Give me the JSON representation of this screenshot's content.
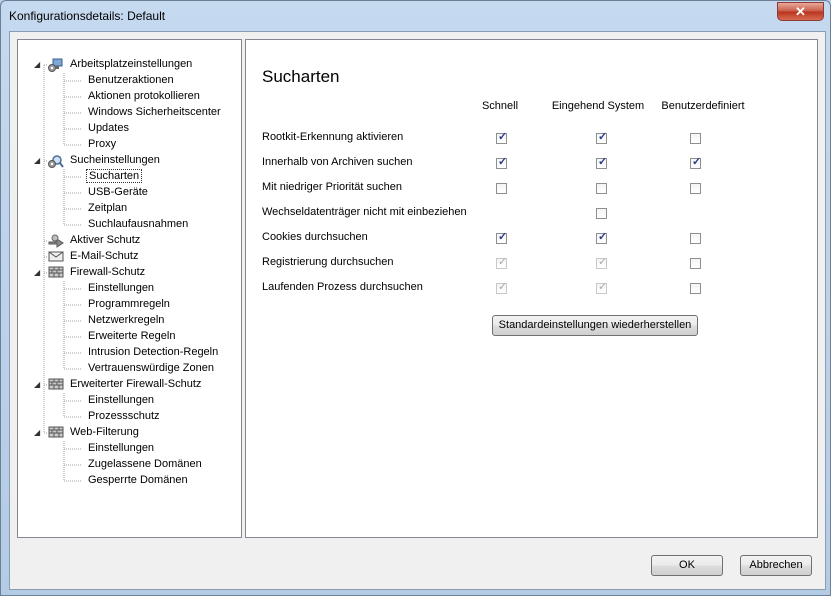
{
  "window": {
    "title": "Konfigurationsdetails: Default",
    "close_glyph": "✕"
  },
  "tree": {
    "items": [
      {
        "label": "Arbeitsplatzeinstellungen",
        "level": 0,
        "icon": "computer-gear-icon",
        "expanded": true
      },
      {
        "label": "Benutzeraktionen",
        "level": 1
      },
      {
        "label": "Aktionen protokollieren",
        "level": 1
      },
      {
        "label": "Windows Sicherheitscenter",
        "level": 1
      },
      {
        "label": "Updates",
        "level": 1
      },
      {
        "label": "Proxy",
        "level": 1
      },
      {
        "label": "Sucheinstellungen",
        "level": 0,
        "icon": "magnifier-gear-icon",
        "expanded": true
      },
      {
        "label": "Sucharten",
        "level": 1,
        "selected": true
      },
      {
        "label": "USB-Geräte",
        "level": 1
      },
      {
        "label": "Zeitplan",
        "level": 1
      },
      {
        "label": "Suchlaufausnahmen",
        "level": 1
      },
      {
        "label": "Aktiver Schutz",
        "level": 0,
        "icon": "shield-arrow-icon"
      },
      {
        "label": "E-Mail-Schutz",
        "level": 0,
        "icon": "envelope-icon"
      },
      {
        "label": "Firewall-Schutz",
        "level": 0,
        "icon": "brick-wall-icon",
        "expanded": true
      },
      {
        "label": "Einstellungen",
        "level": 1
      },
      {
        "label": "Programmregeln",
        "level": 1
      },
      {
        "label": "Netzwerkregeln",
        "level": 1
      },
      {
        "label": "Erweiterte Regeln",
        "level": 1
      },
      {
        "label": "Intrusion Detection-Regeln",
        "level": 1
      },
      {
        "label": "Vertrauenswürdige Zonen",
        "level": 1
      },
      {
        "label": "Erweiterter Firewall-Schutz",
        "level": 0,
        "icon": "brick-wall-icon",
        "expanded": true
      },
      {
        "label": "Einstellungen",
        "level": 1
      },
      {
        "label": "Prozessschutz",
        "level": 1
      },
      {
        "label": "Web-Filterung",
        "level": 0,
        "icon": "brick-wall-icon",
        "expanded": true
      },
      {
        "label": "Einstellungen",
        "level": 1
      },
      {
        "label": "Zugelassene Domänen",
        "level": 1
      },
      {
        "label": "Gesperrte Domänen",
        "level": 1
      }
    ]
  },
  "content": {
    "title": "Sucharten",
    "columns": [
      "Schnell",
      "Eingehend System",
      "Benutzerdefiniert"
    ],
    "rows": [
      {
        "label": "Rootkit-Erkennung aktivieren",
        "cells": [
          {
            "checked": true,
            "disabled": false
          },
          {
            "checked": true,
            "disabled": false
          },
          {
            "checked": false,
            "disabled": false
          }
        ]
      },
      {
        "label": "Innerhalb von Archiven suchen",
        "cells": [
          {
            "checked": true,
            "disabled": false
          },
          {
            "checked": true,
            "disabled": false
          },
          {
            "checked": true,
            "disabled": false
          }
        ]
      },
      {
        "label": "Mit niedriger Priorität suchen",
        "cells": [
          {
            "checked": false,
            "disabled": false
          },
          {
            "checked": false,
            "disabled": false
          },
          {
            "checked": false,
            "disabled": false
          }
        ]
      },
      {
        "label": "Wechseldatenträger nicht mit einbeziehen",
        "cells": [
          null,
          {
            "checked": false,
            "disabled": false
          },
          null
        ]
      },
      {
        "label": "Cookies durchsuchen",
        "cells": [
          {
            "checked": true,
            "disabled": false
          },
          {
            "checked": true,
            "disabled": false
          },
          {
            "checked": false,
            "disabled": false
          }
        ]
      },
      {
        "label": "Registrierung durchsuchen",
        "cells": [
          {
            "checked": true,
            "disabled": true
          },
          {
            "checked": true,
            "disabled": true
          },
          {
            "checked": false,
            "disabled": false
          }
        ]
      },
      {
        "label": "Laufenden Prozess durchsuchen",
        "cells": [
          {
            "checked": true,
            "disabled": true
          },
          {
            "checked": true,
            "disabled": true
          },
          {
            "checked": false,
            "disabled": false
          }
        ]
      }
    ],
    "restore_button": "Standardeinstellungen wiederherstellen"
  },
  "footer": {
    "ok_label": "OK",
    "cancel_label": "Abbrechen"
  }
}
